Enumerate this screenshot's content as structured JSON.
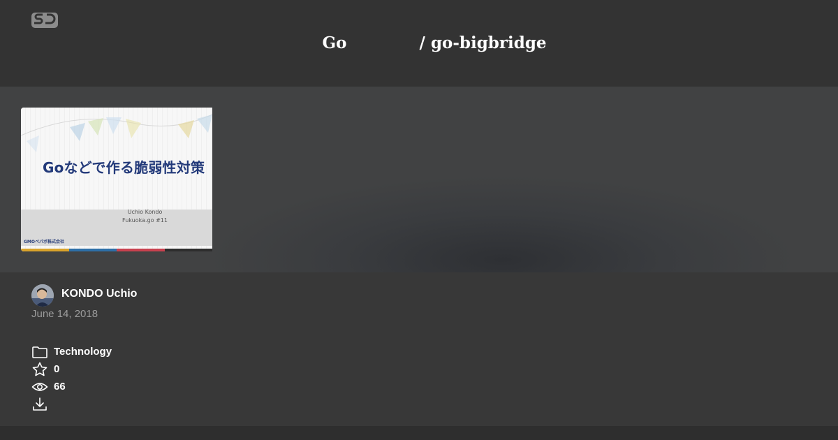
{
  "header": {
    "title": "Go             / go-bigbridge"
  },
  "slide": {
    "title": "Goなどで作る脆弱性対策",
    "author": "Uchio Kondo",
    "event": "Fukuoka.go #11",
    "company": "GMOペパボ株式会社",
    "bar_colors": [
      "#d9a32b",
      "#2d6fa8",
      "#c8414f",
      "#2d2d2d"
    ]
  },
  "deck": {
    "author_name": "KONDO Uchio",
    "date": "June 14, 2018",
    "category": "Technology",
    "stars": "0",
    "views": "66"
  },
  "icons": {
    "logo": "speakerdeck-logo-icon",
    "category": "folder-icon",
    "stars": "star-icon",
    "views": "eye-icon",
    "download": "download-icon"
  }
}
